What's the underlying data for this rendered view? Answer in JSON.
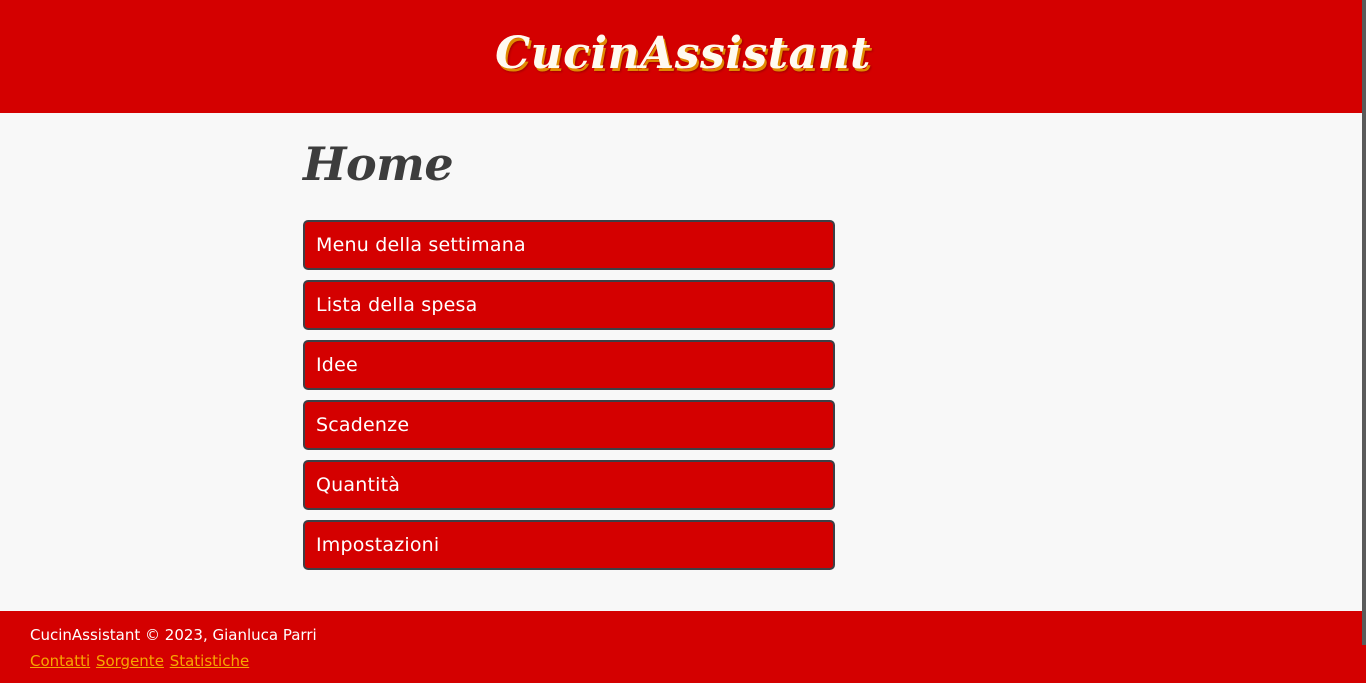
{
  "header": {
    "brand": "CucinAssistant"
  },
  "main": {
    "title": "Home",
    "menu": [
      {
        "label": "Menu della settimana"
      },
      {
        "label": "Lista della spesa"
      },
      {
        "label": "Idee"
      },
      {
        "label": "Scadenze"
      },
      {
        "label": "Quantità"
      },
      {
        "label": "Impostazioni"
      }
    ]
  },
  "footer": {
    "copyright": "CucinAssistant © 2023, Gianluca Parri",
    "links": [
      {
        "label": "Contatti"
      },
      {
        "label": "Sorgente"
      },
      {
        "label": "Statistiche"
      }
    ]
  },
  "colors": {
    "primary": "#d40000",
    "link": "#f7a600",
    "background": "#f8f8f8",
    "title": "#3d3d3d"
  }
}
